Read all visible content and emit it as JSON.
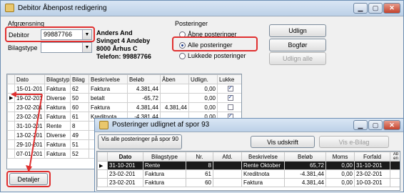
{
  "main_window": {
    "title": "Debitor Åbenpost redigering",
    "filter_label": "Afgrænsning",
    "debitor_label": "Debitor",
    "debitor_value": "99887766",
    "bilagstype_label": "Bilagstype",
    "bilagstype_value": "",
    "customer_name": "Anders And",
    "customer_address": "Svinget 4 Andeby",
    "customer_city": "8000 Århus C",
    "customer_phone": "Telefon: 99887766",
    "postings_label": "Posteringer",
    "radio_open": "Åbne posteringer",
    "radio_all": "Alle posteringer",
    "radio_closed": "Lukkede posteringer",
    "selected_radio": "all",
    "btn_udlign": "Udlign",
    "btn_bogfor": "Bogfør",
    "btn_udlign_alle": "Udlign alle",
    "btn_detaljer": "Detaljer",
    "columns": [
      "Dato",
      "Bilagstyp",
      "Bilag",
      "Beskrivelse",
      "Beløb",
      "Åben",
      "Udlign.",
      "Lukke"
    ],
    "rows": [
      {
        "dato": "15-01-201",
        "type": "Faktura",
        "bilag": "62",
        "beskr": "Faktura",
        "belob": "4.381,44",
        "aaben": "",
        "udlign": "0,00",
        "lukke": true,
        "current": false
      },
      {
        "dato": "19-02-201",
        "type": "Diverse",
        "bilag": "50",
        "beskr": "betalt",
        "belob": "-65,72",
        "aaben": "",
        "udlign": "0,00",
        "lukke": true,
        "current": true
      },
      {
        "dato": "23-02-201",
        "type": "Faktura",
        "bilag": "60",
        "beskr": "Faktura",
        "belob": "4.381,44",
        "aaben": "4.381,44",
        "udlign": "0,00",
        "lukke": false,
        "current": false
      },
      {
        "dato": "23-02-201",
        "type": "Faktura",
        "bilag": "61",
        "beskr": "Kreditnota",
        "belob": "-4.381,44",
        "aaben": "",
        "udlign": "0,00",
        "lukke": true,
        "current": false
      },
      {
        "dato": "31-10-201",
        "type": "Rente",
        "bilag": "8",
        "beskr": "",
        "belob": "",
        "aaben": "",
        "udlign": "",
        "lukke": false,
        "current": false
      },
      {
        "dato": "13-02-201",
        "type": "Diverse",
        "bilag": "49",
        "beskr": "",
        "belob": "",
        "aaben": "",
        "udlign": "",
        "lukke": false,
        "current": false
      },
      {
        "dato": "29-10-201",
        "type": "Faktura",
        "bilag": "51",
        "beskr": "",
        "belob": "",
        "aaben": "",
        "udlign": "",
        "lukke": false,
        "current": false
      },
      {
        "dato": "07-01-201",
        "type": "Faktura",
        "bilag": "52",
        "beskr": "",
        "belob": "",
        "aaben": "",
        "udlign": "",
        "lukke": false,
        "current": false
      }
    ]
  },
  "popup": {
    "title": "Posteringer udlignet af spor 93",
    "btn_vis_alle": "Vis alle posteringer på spor 90",
    "btn_vis_udskrift": "Vis udskrift",
    "btn_vis_ebilag": "Vis e-Bilag",
    "columns": [
      "Dato",
      "Bilagstype",
      "Nr.",
      "Afd.",
      "Beskrivelse",
      "Beløb",
      "Moms",
      "Forfald",
      "Åb en"
    ],
    "rows": [
      {
        "dato": "31-10-201",
        "type": "Rente",
        "nr": "8",
        "afd": "",
        "beskr": "Rente Oktober",
        "belob": "65,72",
        "moms": "0,00",
        "forfald": "31-10-201",
        "selected": true
      },
      {
        "dato": "23-02-201",
        "type": "Faktura",
        "nr": "61",
        "afd": "",
        "beskr": "Kreditnota",
        "belob": "-4.381,44",
        "moms": "0,00",
        "forfald": "23-02-201",
        "selected": false
      },
      {
        "dato": "23-02-201",
        "type": "Faktura",
        "nr": "60",
        "afd": "",
        "beskr": "Faktura",
        "belob": "4.381,44",
        "moms": "0,00",
        "forfald": "10-03-201",
        "selected": false
      }
    ]
  },
  "colors": {
    "annotation": "#e03030",
    "titlebar": "#c6d8ee"
  }
}
